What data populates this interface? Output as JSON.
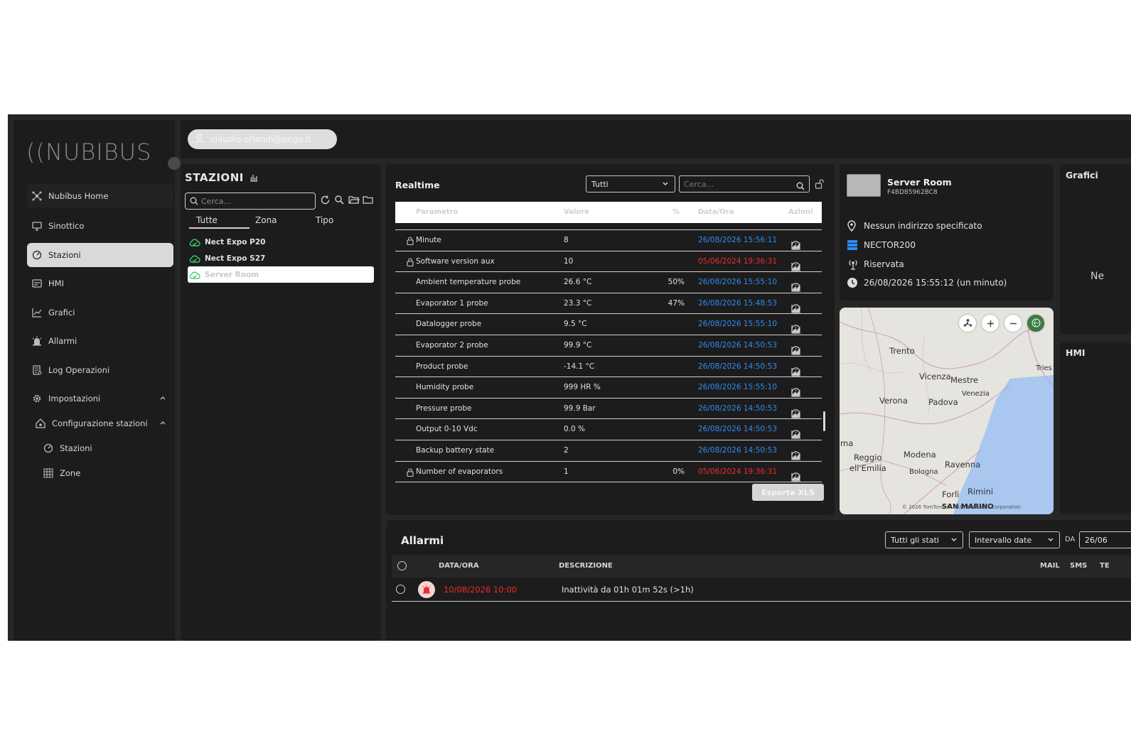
{
  "brand": {
    "logo_text": "NUBIBUS"
  },
  "topbar": {
    "user_email": "claudio.orlandi@pego.it"
  },
  "sidebar": {
    "items": [
      {
        "label": "Nubibus Home",
        "icon": "network-icon"
      },
      {
        "label": "Sinottico",
        "icon": "monitor-icon"
      },
      {
        "label": "Stazioni",
        "icon": "gauge-icon"
      },
      {
        "label": "HMI",
        "icon": "panel-icon"
      },
      {
        "label": "Grafici",
        "icon": "chart-line-icon"
      },
      {
        "label": "Allarmi",
        "icon": "alarm-light-icon"
      },
      {
        "label": "Log Operazioni",
        "icon": "log-icon"
      },
      {
        "label": "Impostazioni",
        "icon": "gear-icon"
      },
      {
        "label": "Configurazione stazioni",
        "icon": "home-gear-icon"
      },
      {
        "label": "Stazioni",
        "icon": "gauge-icon"
      },
      {
        "label": "Zone",
        "icon": "grid-icon"
      }
    ]
  },
  "stations_panel": {
    "title": "STAZIONI",
    "search_placeholder": "Cerca...",
    "tabs": [
      "Tutte",
      "Zona",
      "Tipo"
    ],
    "stations": [
      "Nect Expo P20",
      "Nect Expo S27",
      "Server Room"
    ]
  },
  "realtime": {
    "title": "Realtime",
    "filter_value": "Tutti",
    "search_placeholder": "Cerca...",
    "columns": [
      "Parametro",
      "Valore",
      "%",
      "Data/Ora",
      "Azioni"
    ],
    "rows": [
      {
        "name": "Minute",
        "value": "8",
        "pct": "",
        "date": "26/08/2026 15:56:11",
        "date_status": "ok",
        "locked": true
      },
      {
        "name": "Software version aux",
        "value": "10",
        "pct": "",
        "date": "05/06/2024 19:36:31",
        "date_status": "stale",
        "locked": true
      },
      {
        "name": "Ambient temperature probe",
        "value": "26.6 °C",
        "pct": "50%",
        "date": "26/08/2026 15:55:10",
        "date_status": "ok",
        "locked": false
      },
      {
        "name": "Evaporator 1 probe",
        "value": "23.3 °C",
        "pct": "47%",
        "date": "26/08/2026 15:48:53",
        "date_status": "ok",
        "locked": false
      },
      {
        "name": "Datalogger probe",
        "value": "9.5 °C",
        "pct": "",
        "date": "26/08/2026 15:55:10",
        "date_status": "ok",
        "locked": false
      },
      {
        "name": "Evaporator 2 probe",
        "value": "99.9 °C",
        "pct": "",
        "date": "26/08/2026 14:50:53",
        "date_status": "ok",
        "locked": false
      },
      {
        "name": "Product probe",
        "value": "-14.1 °C",
        "pct": "",
        "date": "26/08/2026 14:50:53",
        "date_status": "ok",
        "locked": false
      },
      {
        "name": "Humidity probe",
        "value": "999 HR %",
        "pct": "",
        "date": "26/08/2026 15:55:10",
        "date_status": "ok",
        "locked": false
      },
      {
        "name": "Pressure probe",
        "value": "99.9 Bar",
        "pct": "",
        "date": "26/08/2026 14:50:53",
        "date_status": "ok",
        "locked": false
      },
      {
        "name": "Output 0-10 Vdc",
        "value": "0.0 %",
        "pct": "",
        "date": "26/08/2026 14:50:53",
        "date_status": "ok",
        "locked": false
      },
      {
        "name": "Backup battery state",
        "value": "2",
        "pct": "",
        "date": "26/08/2026 14:50:53",
        "date_status": "ok",
        "locked": false
      },
      {
        "name": "Number of evaporators",
        "value": "1",
        "pct": "0%",
        "date": "05/06/2024 19:36:31",
        "date_status": "stale",
        "locked": true
      }
    ],
    "export_label": "Esporta XLS"
  },
  "server": {
    "name": "Server Room",
    "id": "F4BD85962BC8",
    "address": "Nessun indirizzo specificato",
    "device": "NECTOR200",
    "access": "Riservata",
    "last_seen": "26/08/2026 15:55:12 (un minuto)"
  },
  "map": {
    "labels": [
      "Trento",
      "Vicenza",
      "Mestre",
      "Venezia",
      "Verona",
      "Padova",
      "Tries",
      "Reggio",
      "ell'Emilia",
      "Modena",
      "Bologna",
      "Ravenna",
      "Forlì",
      "Rimini",
      "SAN MARINO",
      "ma"
    ],
    "copyright": "© 2026 TomTom, © 2026 Microsoft Corporation"
  },
  "grafici": {
    "title": "Grafici",
    "empty_text": "Ne"
  },
  "hmi": {
    "title": "HMI"
  },
  "alarms": {
    "title": "Allarmi",
    "status_filter": "Tutti gli stati",
    "range_filter": "Intervallo date",
    "from_label": "DA",
    "from_value": "26/06",
    "columns": [
      "DATA/ORA",
      "DESCRIZIONE",
      "MAIL",
      "SMS",
      "TE"
    ],
    "rows": [
      {
        "date": "10/08/2026 10:00",
        "description": "Inattività da 01h 01m 52s (>1h)"
      }
    ]
  },
  "colors": {
    "accent_blue": "#2f8cf2",
    "alarm_red": "#ee2b2b",
    "online_green": "#3ecf6b"
  }
}
